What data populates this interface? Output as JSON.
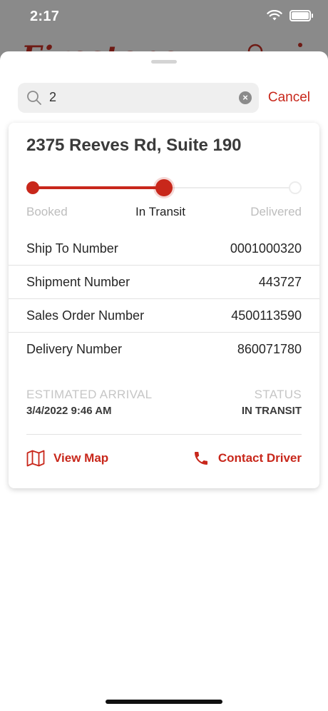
{
  "status_bar": {
    "time": "2:17"
  },
  "background": {
    "brand": "Firestone"
  },
  "search": {
    "query": "2",
    "cancel_label": "Cancel"
  },
  "shipment": {
    "address": "2375 Reeves Rd, Suite 190",
    "progress": {
      "steps": [
        "Booked",
        "In Transit",
        "Delivered"
      ],
      "current_step": 2
    },
    "details": [
      {
        "label": "Ship To Number",
        "value": "0001000320"
      },
      {
        "label": "Shipment Number",
        "value": "443727"
      },
      {
        "label": "Sales Order Number",
        "value": "4500113590"
      },
      {
        "label": "Delivery Number",
        "value": "860071780"
      }
    ],
    "estimated_arrival_label": "ESTIMATED ARRIVAL",
    "estimated_arrival": "3/4/2022 9:46 AM",
    "status_label": "STATUS",
    "status": "IN TRANSIT",
    "actions": {
      "view_map": "View Map",
      "contact_driver": "Contact Driver"
    }
  },
  "colors": {
    "accent": "#c8271b"
  }
}
